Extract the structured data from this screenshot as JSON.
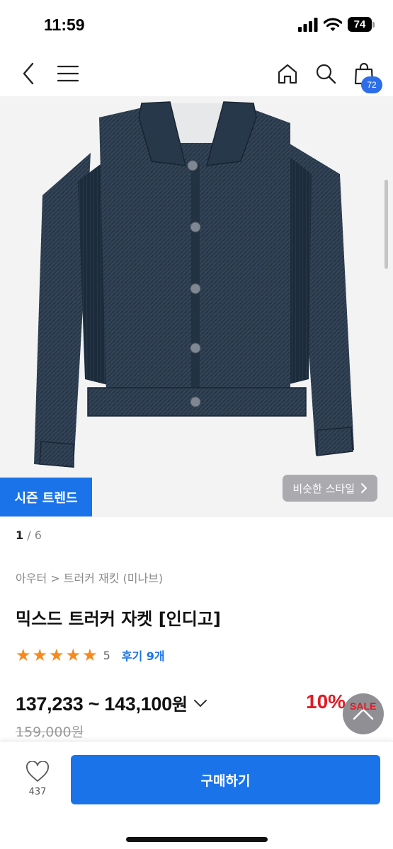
{
  "status": {
    "time": "11:59",
    "battery": "74"
  },
  "nav": {
    "cart_count": "72"
  },
  "image": {
    "season_tag": "시즌 트렌드",
    "similar_style": "비슷한 스타일",
    "pager_current": "1",
    "pager_sep": " / ",
    "pager_total": "6"
  },
  "product": {
    "breadcrumb": "아우터 > 트러커 재킷 (미나브)",
    "title": "믹스드 트러커 자켓 [인디고]",
    "rating": {
      "stars": 5,
      "value": "5",
      "reviews": "후기 9개"
    },
    "price_range": "137,233 ~ 143,100",
    "price_unit": "원",
    "discount": "10%",
    "sale_label": "SALE",
    "original_price": "159,000원"
  },
  "bottom": {
    "wish_count": "437",
    "buy_label": "구매하기"
  },
  "colors": {
    "accent": "#1a73e8",
    "sale": "#e01b24",
    "star": "#f58a1f",
    "jacket": "#2a3a4c"
  }
}
